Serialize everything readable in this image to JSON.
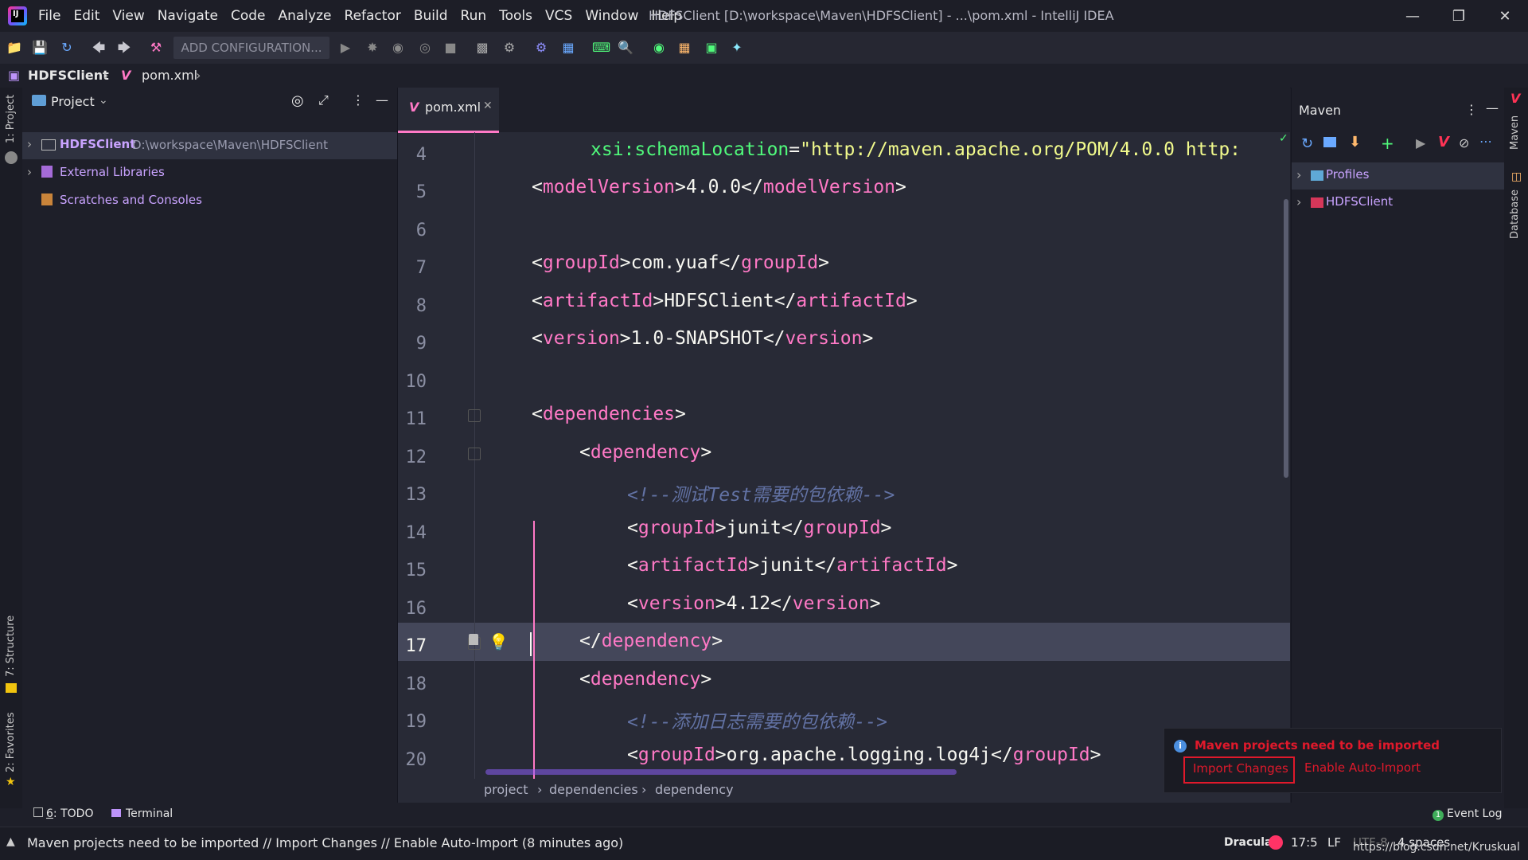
{
  "window": {
    "title": "HDFSClient [D:\\workspace\\Maven\\HDFSClient] - ...\\pom.xml - IntelliJ IDEA",
    "menu": [
      "File",
      "Edit",
      "View",
      "Navigate",
      "Code",
      "Analyze",
      "Refactor",
      "Build",
      "Run",
      "Tools",
      "VCS",
      "Window",
      "Help"
    ]
  },
  "toolbar": {
    "add_configuration": "ADD CONFIGURATION..."
  },
  "breadcrumb": {
    "project": "HDFSClient",
    "file": "pom.xml"
  },
  "side_tabs": {
    "project": "1: Project",
    "structure": "7: Structure",
    "favorites": "2: Favorites",
    "maven": "Maven",
    "database": "Database"
  },
  "project_panel": {
    "title": "Project",
    "tree": [
      {
        "name": "HDFSClient",
        "path": "D:\\workspace\\Maven\\HDFSClient"
      },
      {
        "name": "External Libraries"
      },
      {
        "name": "Scratches and Consoles"
      }
    ]
  },
  "editor": {
    "tab": "pom.xml",
    "current_line": 17,
    "lines": [
      {
        "n": "4"
      },
      {
        "n": "5"
      },
      {
        "n": "6"
      },
      {
        "n": "7"
      },
      {
        "n": "8"
      },
      {
        "n": "9"
      },
      {
        "n": "10"
      },
      {
        "n": "11"
      },
      {
        "n": "12"
      },
      {
        "n": "13"
      },
      {
        "n": "14"
      },
      {
        "n": "15"
      },
      {
        "n": "16"
      },
      {
        "n": "17"
      },
      {
        "n": "18"
      },
      {
        "n": "19"
      },
      {
        "n": "20"
      }
    ],
    "code": {
      "l4_attr": "xsi",
      "l4_colon": ":",
      "l4_attr2": "schemaLocation",
      "l4_eq": "=",
      "l4_val": "\"http://maven.apache.org/POM/4.0.0 http:",
      "modelVersion_tag": "modelVersion",
      "modelVersion_val": "4.0.0",
      "groupId_tag": "groupId",
      "groupId_val": "com.yuaf",
      "artifactId_tag": "artifactId",
      "artifactId_val": "HDFSClient",
      "version_tag": "version",
      "version_val": "1.0-SNAPSHOT",
      "dependencies_tag": "dependencies",
      "dependency_tag": "dependency",
      "comment1": "<!--测试Test需要的包依赖-->",
      "junit_group": "junit",
      "junit_artifact": "junit",
      "junit_version": "4.12",
      "comment2": "<!--添加日志需要的包依赖-->",
      "log4j_group": "org.apache.logging.log4j"
    },
    "breadcrumbs": [
      "project",
      "dependencies",
      "dependency"
    ]
  },
  "maven_panel": {
    "title": "Maven",
    "tree": [
      "Profiles",
      "HDFSClient"
    ]
  },
  "notification": {
    "message": "Maven projects need to be imported",
    "import_changes": "Import Changes",
    "enable_auto_import": "Enable Auto-Import"
  },
  "bottom_tabs": {
    "todo_prefix": "6",
    "todo": ": TODO",
    "terminal": "Terminal",
    "event_log": "Event Log",
    "event_count": "1"
  },
  "status_bar": {
    "message": "Maven projects need to be imported // Import Changes // Enable Auto-Import (8 minutes ago)",
    "theme": "Dracula",
    "position": "17:5",
    "line_sep": "LF",
    "encoding": "UTF-8",
    "indent": "4 spaces",
    "watermark": "https://blog.csdn.net/Kruskual"
  },
  "colors": {
    "accent": "#ff79c6",
    "notif_red": "#e0192b",
    "bg": "#282a36"
  }
}
